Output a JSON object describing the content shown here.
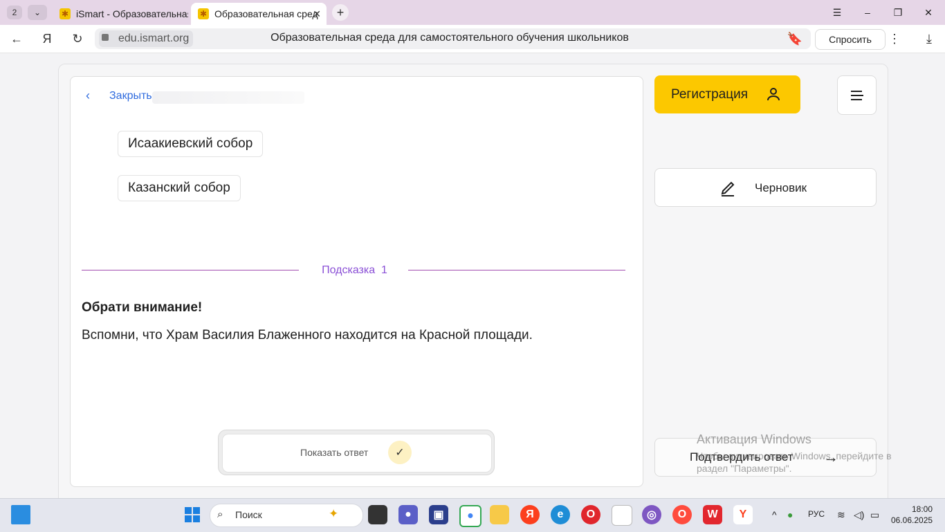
{
  "browser": {
    "tab_count": "2",
    "tabs": [
      {
        "title": "iSmart - Образовательная",
        "active": false
      },
      {
        "title": "Образовательная сред",
        "active": true
      }
    ],
    "domain": "edu.ismart.org",
    "page_title": "Образовательная среда для самостоятельного обучения школьников",
    "ask_label": "Спросить"
  },
  "task": {
    "close_label": "Закрыть",
    "options": [
      "Исаакиевский собор",
      "Казанский собор"
    ],
    "hint_label": "Подсказка",
    "hint_number": "1",
    "hint_title": "Обрати внимание!",
    "hint_text": "Вспомни, что Храм Василия Блаженного находится на Красной площади.",
    "show_answer_label": "Показать ответ"
  },
  "sidebar": {
    "register_label": "Регистрация",
    "draft_label": "Черновик",
    "confirm_label": "Подтвердить ответ"
  },
  "watermark": {
    "title": "Активация Windows",
    "text": "Чтобы активировать Windows, перейдите в раздел \"Параметры\"."
  },
  "taskbar": {
    "search_placeholder": "Поиск",
    "language": "РУС",
    "time": "18:00",
    "date": "06.06.2025"
  },
  "colors": {
    "accent_yellow": "#fcc800",
    "link_blue": "#2f6bde",
    "hint_purple": "#8a4fd6"
  }
}
